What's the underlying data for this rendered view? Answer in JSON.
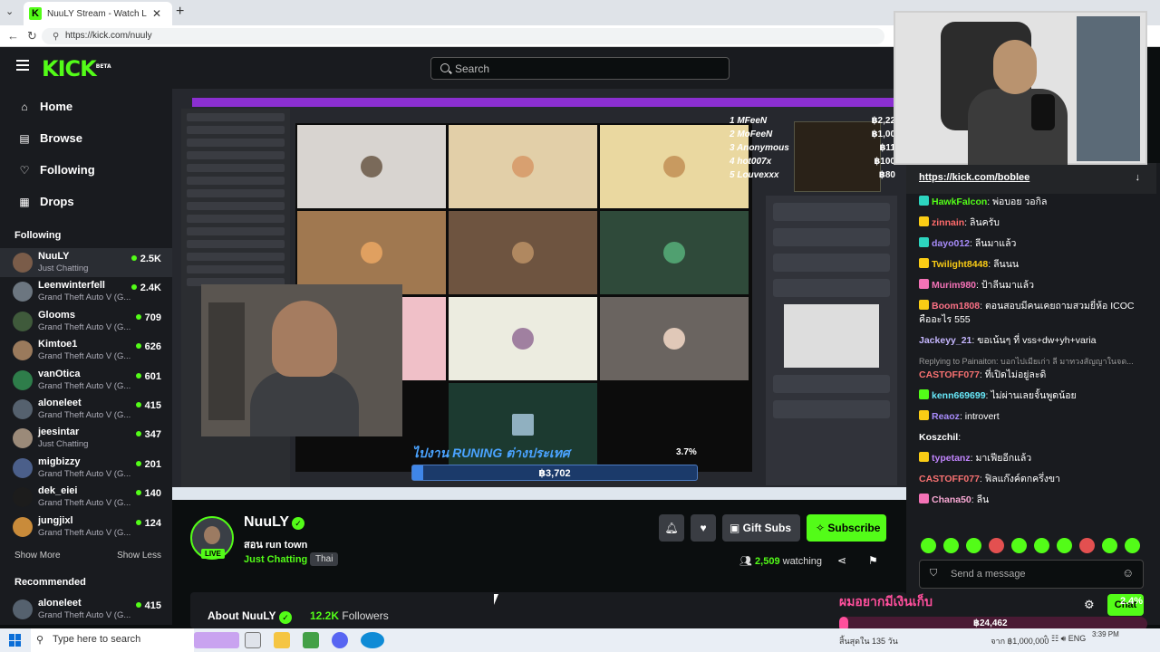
{
  "browser": {
    "tab_title": "NuuLY Stream - Watch Live o",
    "url": "https://kick.com/nuuly"
  },
  "header": {
    "logo_text": "KICK",
    "logo_sup": "BETA",
    "search_placeholder": "Search"
  },
  "sidebar": {
    "nav": [
      {
        "label": "Home",
        "icon": "home-icon",
        "glyph": "⌂"
      },
      {
        "label": "Browse",
        "icon": "browse-icon",
        "glyph": "▤"
      },
      {
        "label": "Following",
        "icon": "heart-icon",
        "glyph": "♡"
      },
      {
        "label": "Drops",
        "icon": "drops-icon",
        "glyph": "▦"
      }
    ],
    "following_title": "Following",
    "following": [
      {
        "name": "NuuLY",
        "category": "Just Chatting",
        "viewers": "2.5K",
        "color": "#7a5c49"
      },
      {
        "name": "Leenwinterfell",
        "category": "Grand Theft Auto V (G...",
        "viewers": "2.4K",
        "color": "#6c7680"
      },
      {
        "name": "Glooms",
        "category": "Grand Theft Auto V (G...",
        "viewers": "709",
        "color": "#3f5a3b"
      },
      {
        "name": "Kimtoe1",
        "category": "Grand Theft Auto V (G...",
        "viewers": "626",
        "color": "#9a7a5c"
      },
      {
        "name": "vanOtica",
        "category": "Grand Theft Auto V (G...",
        "viewers": "601",
        "color": "#2e7d4a"
      },
      {
        "name": "aloneleet",
        "category": "Grand Theft Auto V (G...",
        "viewers": "415",
        "color": "#55616e"
      },
      {
        "name": "jeesintar",
        "category": "Just Chatting",
        "viewers": "347",
        "color": "#9b8a79"
      },
      {
        "name": "migbizzy",
        "category": "Grand Theft Auto V (G...",
        "viewers": "201",
        "color": "#4b5f8a"
      },
      {
        "name": "dek_eiei",
        "category": "Grand Theft Auto V (G...",
        "viewers": "140",
        "color": "#1c1c1c"
      },
      {
        "name": "jungjixl",
        "category": "Grand Theft Auto V (G...",
        "viewers": "124",
        "color": "#c98b3a"
      }
    ],
    "show_more": "Show More",
    "show_less": "Show Less",
    "recommended_title": "Recommended",
    "recommended": [
      {
        "name": "aloneleet",
        "category": "Grand Theft Auto V (G...",
        "viewers": "415",
        "color": "#55616e"
      }
    ]
  },
  "stream": {
    "donors": [
      "MFeeN",
      "MoFeeN",
      "Anonymous",
      "hot007x",
      "Louvexxx"
    ],
    "donor_ranks": [
      "1",
      "2",
      "3",
      "4",
      "5"
    ],
    "donor_amounts": [
      "฿2,22",
      "฿1,00",
      "฿11",
      "฿100",
      "฿80"
    ],
    "goal_title": "ไปงาน RUNING ต่างประเทศ",
    "goal_percent": "3.7%",
    "goal_progress": 0.037,
    "goal_amount": "฿3,702"
  },
  "channel": {
    "name": "NuuLY",
    "stream_title": "สอน run town",
    "category": "Just Chatting",
    "language": "Thai",
    "live_label": "LIVE",
    "gift_subs_label": "Gift Subs",
    "subscribe_label": "Subscribe",
    "watching_count": "2,509",
    "watching_label": "watching",
    "about_label": "About NuuLY",
    "followers_count": "12.2K",
    "followers_label": "Followers"
  },
  "chat": {
    "pinned_link": "https://kick.com/boblee",
    "messages": [
      {
        "user": "HawkFalcon",
        "text": "พ่อบอย วอกิล",
        "color": "#53fc18",
        "badge": "#2dd4bf"
      },
      {
        "user": "zinnain",
        "text": "ลินครับ",
        "color": "#ff6b6b",
        "badge": "#facc15"
      },
      {
        "user": "dayo012",
        "text": "ลีนมาแล้ว",
        "color": "#a78bfa",
        "badge": "#2dd4bf"
      },
      {
        "user": "Twilight8448",
        "text": "ลีนนน",
        "color": "#facc15",
        "badge": "#facc15"
      },
      {
        "user": "Murim980",
        "text": "ป้าลีนมาแล้ว",
        "color": "#f472b6",
        "badge": "#f472b6"
      },
      {
        "user": "Boom1808",
        "text": "ตอนสอบมีคนเคยถามสวมยี่ห้อ ICOC คืออะไร 555",
        "color": "#fb7185",
        "badge": "#facc15"
      },
      {
        "user": "Jackeyy_21",
        "text": "ขอเน้นๆ ที่ vss+dw+yh+varia",
        "color": "#c4b5fd",
        "badge": ""
      },
      {
        "user": "CASTOFF077",
        "text": "ที่เปิดไม่อยู่ละดิ",
        "color": "#f87171",
        "badge": "",
        "reply": "Replying to Painaiton: บอกไปเมียเก่า ลี มาทวงสัญญาในจด..."
      },
      {
        "user": "kenn669699",
        "text": "ไม่ผ่านเลยจั้นพูดน้อย",
        "color": "#67e8f9",
        "badge": "#53fc18"
      },
      {
        "user": "Reaoz",
        "text": "introvert",
        "color": "#a78bfa",
        "badge": "#facc15"
      },
      {
        "user": "Koszchil",
        "text": "",
        "color": "#ffffff",
        "badge": ""
      },
      {
        "user": "typetanz",
        "text": "มาเฟียอีกแล้ว",
        "color": "#c084fc",
        "badge": "#facc15"
      },
      {
        "user": "CASTOFF077",
        "text": "ฟิลแก๊งค์ตกครึ่งขา",
        "color": "#f87171",
        "badge": ""
      },
      {
        "user": "Chana50",
        "text": "ลีน",
        "color": "#f9a8d4",
        "badge": "#f472b6"
      }
    ],
    "input_placeholder": "Send a message",
    "chat_button": "Chat"
  },
  "bottom_goal": {
    "title": "ผมอยากมีเงินเก็บ",
    "percent": "2.4%",
    "progress": 0.024,
    "amount": "฿24,462",
    "days_left": "สิ้นสุดใน 135 วัน",
    "target": "จาก ฿1,000,000"
  },
  "taskbar": {
    "search_placeholder": "Type here to search",
    "lang": "ENG",
    "time": "3:39 PM"
  }
}
